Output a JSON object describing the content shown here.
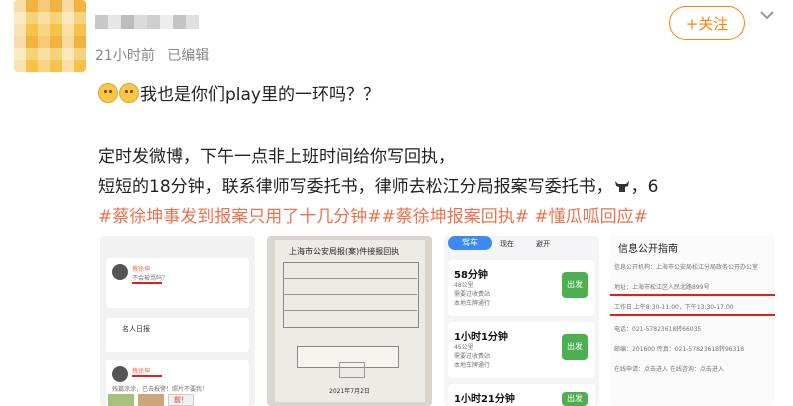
{
  "post": {
    "meta": {
      "time": "21小时前",
      "edited": "已编辑"
    },
    "follow_label": "+关注",
    "line1": "我也是你们play里的一环吗？？",
    "line2": "定时发微博，下午一点非上班时间给你写回执，",
    "line3a": "短短的18分钟，联系律师写委托书，律师去松江分局报案写委托书，",
    "line3b": "，6",
    "tags": [
      "#蔡徐坤事发到报案只用了十几分钟#",
      "#蔡徐坤报案回执#",
      " #懂瓜呱回应#"
    ]
  },
  "thumb1": {
    "name1": "蔡徐坤",
    "sub1": "不会被骂吗？",
    "section": "名人日报",
    "name2": "蔡徐坤",
    "sub2": "残篇涂涂，已去报警！照片不要我！",
    "badge": "前！"
  },
  "thumb2": {
    "title": "上海市公安局报(案)件接报回执",
    "footer": "2021年7月2日"
  },
  "thumb3": {
    "tab_drive": "驾车",
    "tab_recent": "现在",
    "tab_avoid": "避开",
    "routes": [
      {
        "time": "58分钟",
        "dist": "48公里",
        "note1": "需要过收费站",
        "note2": "本地车牌通行",
        "go": "出发"
      },
      {
        "time": "1小时1分钟",
        "dist": "45公里",
        "note1": "需要过收费站",
        "note2": "本地车牌通行",
        "go": "出发"
      },
      {
        "time": "1小时21分钟",
        "dist": "",
        "note1": "",
        "note2": "",
        "go": "出发"
      }
    ]
  },
  "thumb4": {
    "title": "信息公开指南",
    "rows": [
      "信息公开机构：上海市公安局松江分局政务公开办公室",
      "地址：上海市松江区人民北路899号",
      "工作日 上午8:30-11:00，下午13:30-17:00",
      "电话：021-57823618转66035",
      "邮编：201600  传真：021-57823618转96318",
      "在线申请：点击进入  在线咨询：点击进入"
    ]
  },
  "colors": {
    "accent": "#ff8200",
    "tag": "#eb7350",
    "underline": "#e02020",
    "go_button": "#4caf50"
  }
}
